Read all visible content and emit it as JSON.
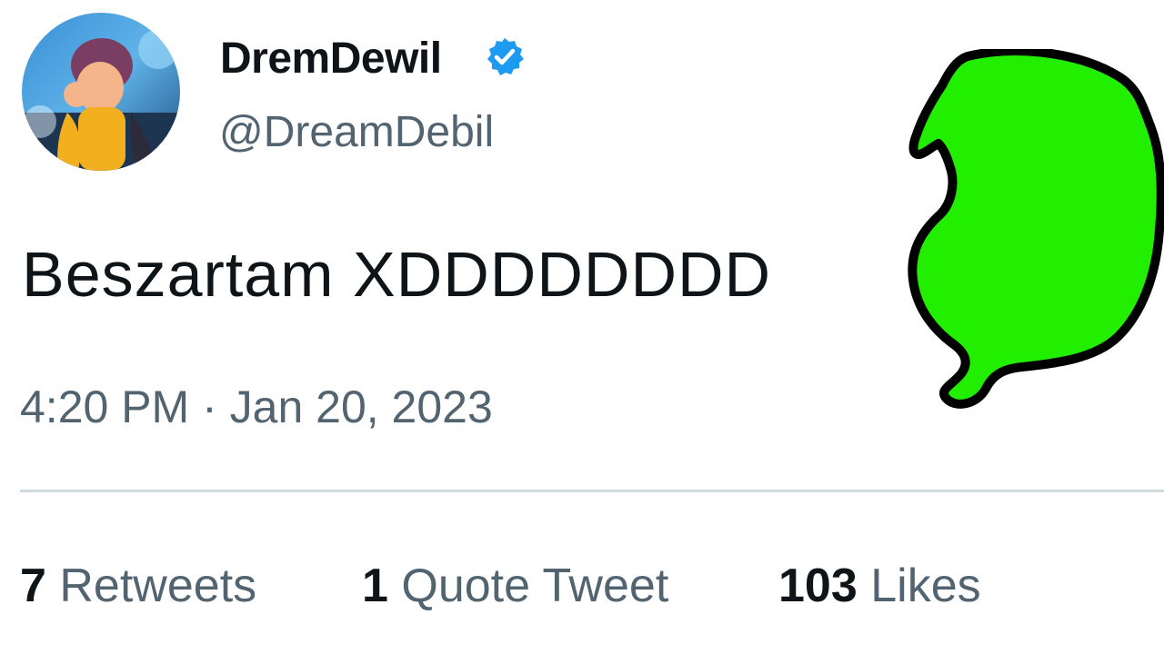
{
  "tweet": {
    "display_name": "DremDewil",
    "handle": "@DreamDebil",
    "text": "Beszartam XDDDDDDDD",
    "timestamp": "4:20 PM · Jan 20, 2023",
    "verified": true
  },
  "stats": {
    "retweets": {
      "count": "7",
      "label": "Retweets"
    },
    "quote_tweets": {
      "count": "1",
      "label": "Quote Tweet"
    },
    "likes": {
      "count": "103",
      "label": "Likes"
    }
  },
  "colors": {
    "text_primary": "#0f1419",
    "text_secondary": "#536471",
    "verified_blue": "#1d9bf0",
    "divider": "#cfd9de",
    "overlay_green": "#22ee00"
  },
  "icons": {
    "verified": "verified-badge-icon",
    "avatar": "profile-avatar",
    "overlay": "green-speech-blob"
  }
}
